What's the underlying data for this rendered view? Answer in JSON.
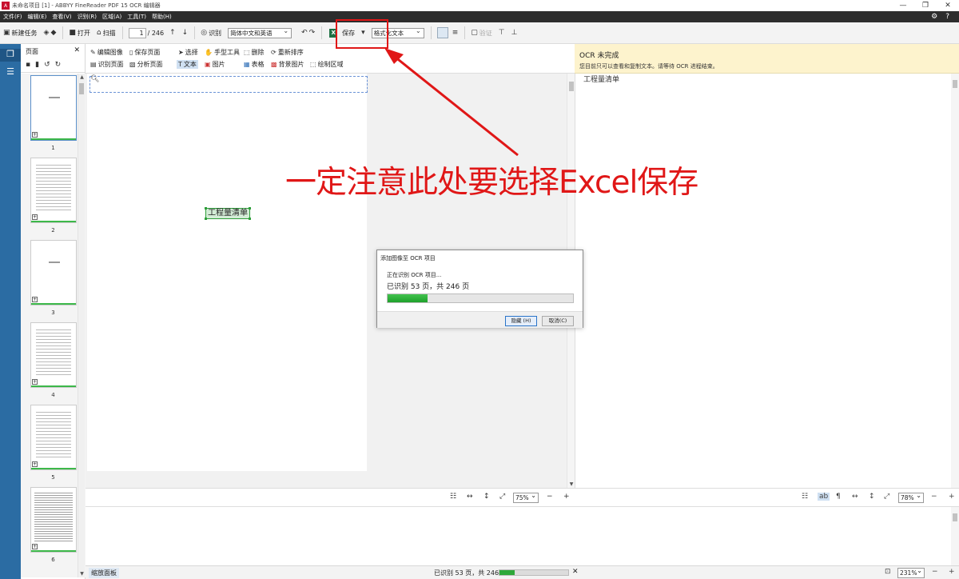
{
  "window": {
    "title": "未命名项目 [1] - ABBYY FineReader PDF 15 OCR 编辑器",
    "controls": [
      "—",
      "❐",
      "✕"
    ]
  },
  "menu": [
    "文件(F)",
    "编辑(E)",
    "查看(V)",
    "识别(R)",
    "区域(A)",
    "工具(T)",
    "帮助(H)"
  ],
  "toolbar": {
    "new_task": "新建任务",
    "open": "打开",
    "scan": "扫描",
    "page_current": "1",
    "page_total": "/ 246",
    "recognize": "识别",
    "language": "简体中文和英语",
    "save": "保存",
    "save_format": "格式化文本",
    "verify": "验证"
  },
  "pages_panel": {
    "title": "页面",
    "thumbnails": [
      "1",
      "2",
      "3",
      "4",
      "5",
      "6"
    ]
  },
  "image_toolbar": {
    "edit_image": "编辑图像",
    "save_page": "保存页面",
    "select": "选择",
    "hand_tool": "手型工具",
    "delete": "删除",
    "reorder": "重新排序",
    "recognize_page": "识别页面",
    "analyze_page": "分析页面",
    "text": "文本",
    "picture": "图片",
    "table": "表格",
    "background_picture": "背景图片",
    "draw_area": "绘制区域"
  },
  "document": {
    "recognized_block": "工程量清单"
  },
  "annotation": {
    "text": "一定注意此处要选择Excel保存",
    "color": "#e01717"
  },
  "dialog": {
    "title": "添加图像至 OCR 项目",
    "status": "正在识别 OCR 项目...",
    "progress_text": "已识别 53 页，共 246 页",
    "progress_fraction": 0.2154,
    "hide_button": "隐藏 (H)",
    "cancel_button": "取消(C)"
  },
  "image_zoom": "75%",
  "ocr_banner": {
    "title": "OCR 未完成",
    "subtitle": "您目前只可以查看和复制文本。请等待 OCR 进程结束。"
  },
  "text_pane": {
    "content": "工程量清单",
    "zoom": "78%"
  },
  "status_bar": {
    "zoom_panel": "缩放面板",
    "progress_text": "已识别 53 页，共 246 页",
    "progress_fraction": 0.2154,
    "zoom": "231%"
  },
  "colors": {
    "rail": "#2b6ca3",
    "progress_green": "#2ea83a",
    "banner": "#fdf3cd",
    "menubar": "#2d2d2d"
  }
}
